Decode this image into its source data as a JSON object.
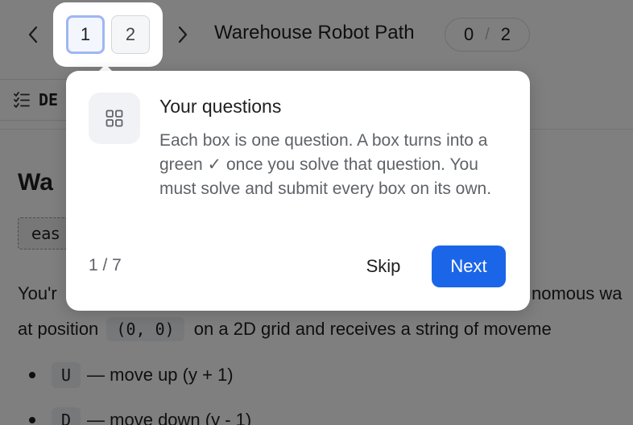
{
  "header": {
    "question_tabs": [
      "1",
      "2"
    ],
    "title": "Warehouse Robot Path",
    "progress": {
      "solved": "0",
      "separator": "/",
      "total": "2"
    }
  },
  "description_tab": {
    "label": "DE"
  },
  "problem": {
    "title": "Wa",
    "difficulty": "eas",
    "intro_start": "You'r",
    "intro_end": "nomous wa",
    "line2_start": "at position",
    "position_code": "(0, 0)",
    "line2_end": "on a 2D grid and receives a string of moveme",
    "moves": [
      {
        "code": "U",
        "text": "— move up (y + 1)"
      },
      {
        "code": "D",
        "text": "— move down (y - 1)"
      }
    ]
  },
  "tour": {
    "title": "Your questions",
    "body": "Each box is one question. A box turns into a green ✓ once you solve that question. You must solve and submit every box on its own.",
    "step": "1 / 7",
    "skip_label": "Skip",
    "next_label": "Next"
  },
  "colors": {
    "accent": "#1b66e8",
    "active_tab_border": "#9fb6f4"
  },
  "icons": {
    "prev": "chevron-left-icon",
    "next": "chevron-right-icon",
    "description": "checklist-icon",
    "tour": "grid-icon"
  }
}
